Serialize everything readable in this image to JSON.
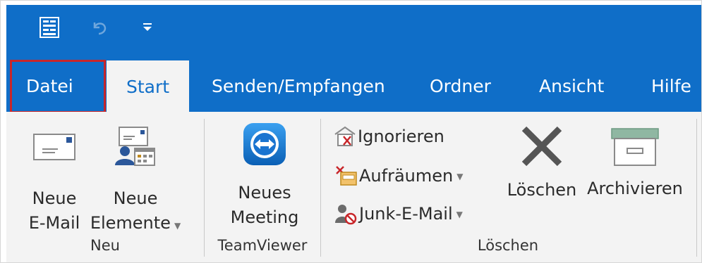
{
  "tabs": [
    {
      "label": "Datei"
    },
    {
      "label": "Start"
    },
    {
      "label": "Senden/Empfangen"
    },
    {
      "label": "Ordner"
    },
    {
      "label": "Ansicht"
    },
    {
      "label": "Hilfe"
    }
  ],
  "ribbon": {
    "new_email": {
      "line1": "Neue",
      "line2": "E-Mail"
    },
    "new_items": {
      "line1": "Neue",
      "line2": "Elemente"
    },
    "new_meeting": {
      "line1": "Neues",
      "line2": "Meeting"
    },
    "ignore": "Ignorieren",
    "cleanup": "Aufräumen",
    "junk": "Junk-E-Mail",
    "delete": "Löschen",
    "archive": "Archivieren"
  },
  "groups": {
    "neu": "Neu",
    "teamviewer": "TeamViewer",
    "loeschen": "Löschen"
  },
  "colors": {
    "accent": "#0f6ec8",
    "highlight": "#c8262a",
    "ribbon_bg": "#f3f3f3"
  },
  "icons": [
    "quick-steps-icon",
    "undo-icon",
    "customize-qat-icon",
    "new-email-icon",
    "new-items-icon",
    "teamviewer-icon",
    "ignore-icon",
    "cleanup-icon",
    "junk-icon",
    "delete-icon",
    "archive-icon"
  ]
}
